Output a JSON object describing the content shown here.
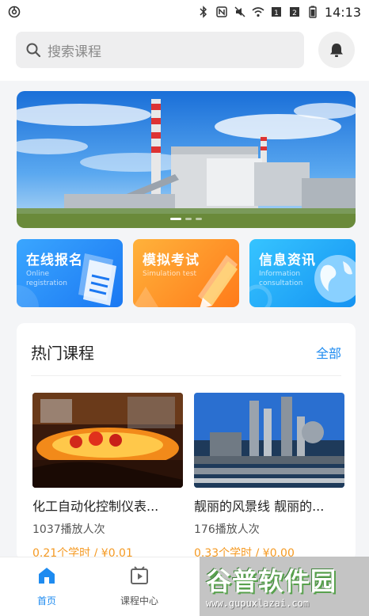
{
  "status_bar": {
    "time": "14:13",
    "icons": [
      "app-logo-icon",
      "bluetooth-icon",
      "nfc-icon",
      "mute-icon",
      "wifi-icon",
      "sim1-icon",
      "sim2-icon",
      "battery-icon"
    ]
  },
  "search": {
    "placeholder": "搜索课程",
    "icon": "search-icon"
  },
  "header": {
    "bell_icon": "bell-icon"
  },
  "banner": {
    "active_index": 0,
    "slide_count": 3
  },
  "quick_entries": [
    {
      "title": "在线报名",
      "subtitle": "Online registration",
      "color": "#1b78f2",
      "icon": "document-icon"
    },
    {
      "title": "模拟考试",
      "subtitle": "Simulation test",
      "color": "#ff7b1a",
      "icon": "pencil-icon"
    },
    {
      "title": "信息资讯",
      "subtitle": "Information consultation",
      "color": "#1593f2",
      "icon": "globe-icon"
    }
  ],
  "hot_courses": {
    "title": "热门课程",
    "all_label": "全部",
    "items": [
      {
        "title": "化工自动化控制仪表...",
        "plays": "1037播放人次",
        "price": "0.21个学时 / ¥0.01"
      },
      {
        "title": "靓丽的风景线 靓丽的...",
        "plays": "176播放人次",
        "price": "0.33个学时 / ¥0.00"
      }
    ]
  },
  "bottom_nav": {
    "tabs": [
      {
        "label": "首页",
        "icon": "home-icon",
        "active": true
      },
      {
        "label": "课程中心",
        "icon": "video-icon",
        "active": false
      }
    ]
  },
  "watermark": {
    "title": "谷普软件园",
    "url": "www.gupuxlazai.com"
  },
  "colors": {
    "accent": "#1e8bf0",
    "price": "#f59a23",
    "background": "#f4f5f7"
  }
}
